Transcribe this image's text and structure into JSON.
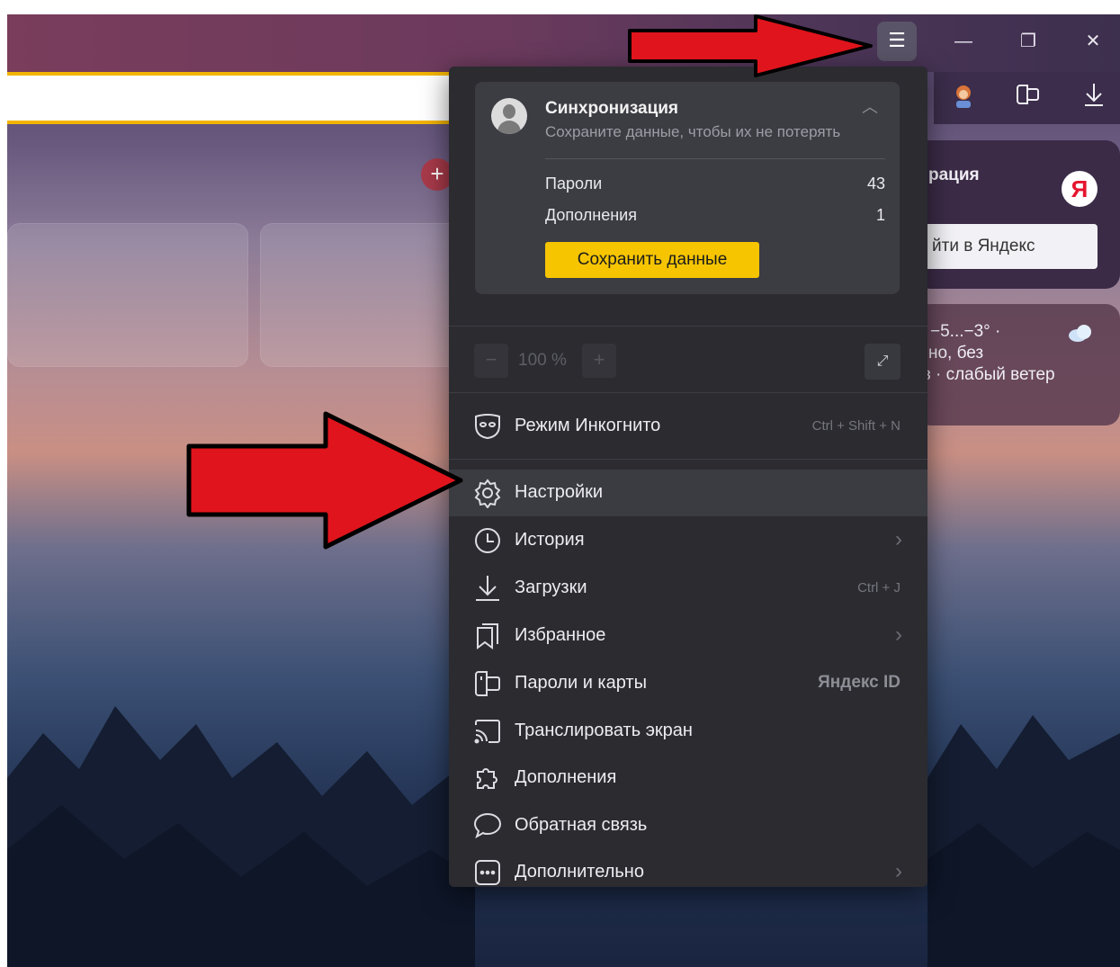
{
  "window": {
    "menu_icon": "hamburger-icon",
    "minimize_icon": "minimize-icon",
    "restore_icon": "restore-icon",
    "close_icon": "close-icon"
  },
  "toolbar": {
    "icons": [
      "avatar-character-icon",
      "passwords-icon",
      "download-icon"
    ]
  },
  "newtab": {
    "add_tile_label": "+",
    "profile_card_title": "рация",
    "login_button": "йти в Яндекс",
    "yandex_logo": "Я",
    "weather_temp": "−5...−3° ·",
    "weather_line2": "но, без",
    "weather_line3": "з · слабый ветер"
  },
  "menu": {
    "sync": {
      "title": "Синхронизация",
      "subtitle": "Сохраните данные, чтобы их не потерять",
      "rows": [
        {
          "label": "Пароли",
          "value": "43"
        },
        {
          "label": "Дополнения",
          "value": "1"
        }
      ],
      "save_button": "Сохранить данные"
    },
    "zoom": {
      "minus": "−",
      "value": "100 %",
      "plus": "+",
      "fullscreen_icon": "fullscreen-icon"
    },
    "items": [
      {
        "label": "Режим Инкогнито",
        "shortcut": "Ctrl + Shift + N",
        "icon": "incognito-mask-icon"
      },
      {
        "label": "Настройки",
        "icon": "gear-icon"
      },
      {
        "label": "История",
        "icon": "clock-icon"
      },
      {
        "label": "Загрузки",
        "shortcut": "Ctrl + J",
        "icon": "download-icon"
      },
      {
        "label": "Избранное",
        "icon": "bookmarks-icon"
      },
      {
        "label": "Пароли и карты",
        "badge": "Яндекс ID",
        "icon": "passwords-cards-icon"
      },
      {
        "label": "Транслировать экран",
        "icon": "cast-icon"
      },
      {
        "label": "Дополнения",
        "icon": "puzzle-icon"
      },
      {
        "label": "Обратная связь",
        "icon": "speech-bubble-icon"
      },
      {
        "label": "Дополнительно",
        "icon": "more-dots-icon"
      }
    ]
  },
  "colors": {
    "accent_yellow": "#f6c500",
    "menu_bg": "#2b2b30",
    "highlight_row": "#3b3b42",
    "annotation_arrow": "#e0141c"
  }
}
